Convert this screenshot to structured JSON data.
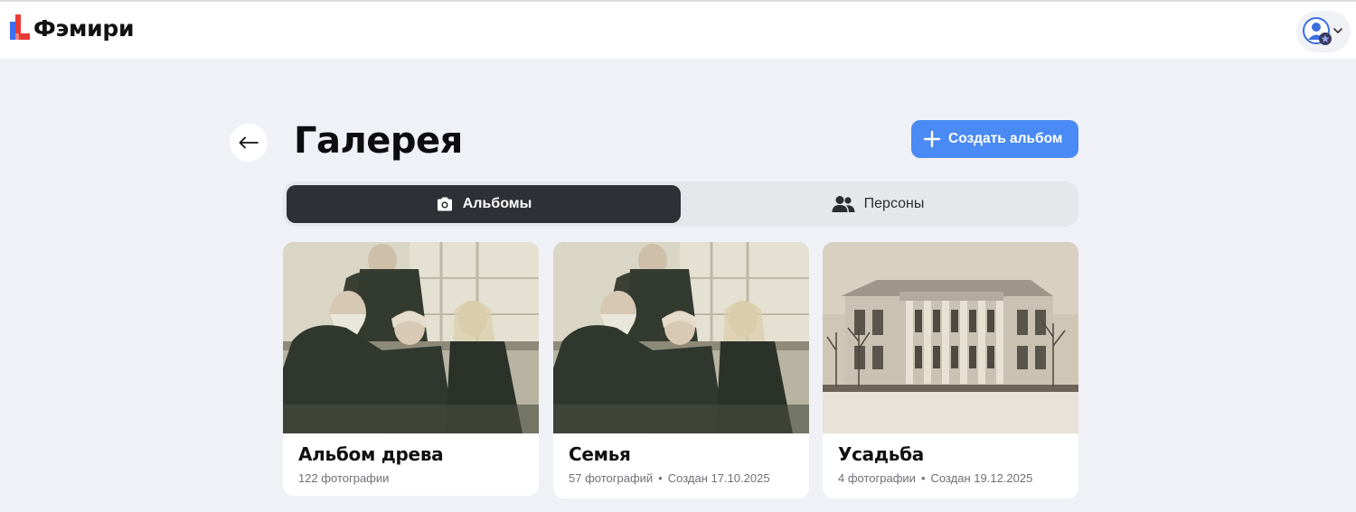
{
  "header": {
    "logo_text": "Фэмири",
    "colors": {
      "logo_blue": "#3d6ff0",
      "logo_red": "#ea3b34",
      "avatar_blue": "#3b6fe0"
    }
  },
  "page": {
    "title": "Галерея",
    "back_icon": "arrow-left-icon",
    "create_button": "Создать альбом",
    "accent_color": "#4a8af4"
  },
  "tabs": [
    {
      "label": "Альбомы",
      "icon": "camera-icon",
      "active": true
    },
    {
      "label": "Персоны",
      "icon": "people-icon",
      "active": false
    }
  ],
  "albums": [
    {
      "name": "Альбом древа",
      "count": "122 фотографии",
      "created": ""
    },
    {
      "name": "Семья",
      "count": "57 фотографий",
      "created": "Создан 17.10.2025"
    },
    {
      "name": "Усадьба",
      "count": "4 фотографии",
      "created": "Создан 19.12.2025"
    }
  ]
}
